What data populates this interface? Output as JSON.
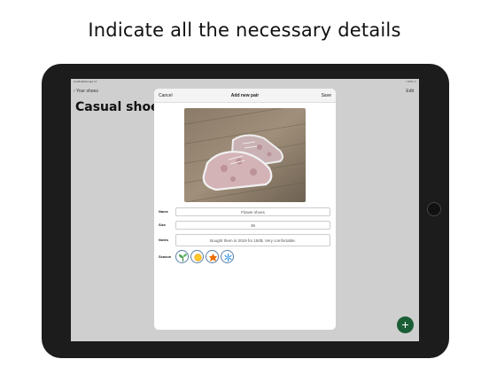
{
  "headline": "Indicate all the necessary details",
  "status_bar": {
    "time": "11:05 AM   Fri Apr 17",
    "right": "≈ 67% ▭"
  },
  "nav": {
    "back_label": "Your shoes",
    "edit_label": "Edit"
  },
  "page_title": "Casual shoes",
  "modal": {
    "cancel_label": "Cancel",
    "title": "Add new pair",
    "save_label": "Save",
    "fields": {
      "name": {
        "label": "Name",
        "value": "Flower shoes"
      },
      "size": {
        "label": "Size",
        "value": "36"
      },
      "notes": {
        "label": "Notes",
        "value": "Bought them in 2019 for 150$. Very comfortable."
      },
      "season": {
        "label": "Season"
      }
    },
    "season_icons": [
      "sprout-icon",
      "sun-icon",
      "leaf-icon",
      "snowflake-icon"
    ]
  },
  "fab_label": "+",
  "colors": {
    "accent_green": "#1b5e35",
    "icon_ring": "#5a7fa8",
    "screen_bg": "#cfcfcf"
  }
}
